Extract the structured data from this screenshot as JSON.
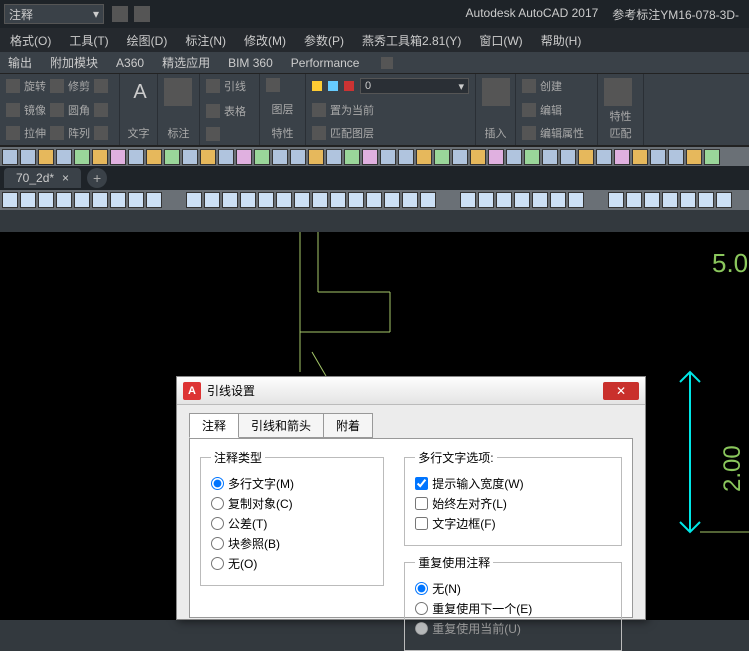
{
  "titlebar": {
    "combo_value": "注释",
    "app": "Autodesk AutoCAD 2017",
    "doc_ref": "参考标注YM16-078-3D-"
  },
  "menubar": [
    "格式(O)",
    "工具(T)",
    "绘图(D)",
    "标注(N)",
    "修改(M)",
    "参数(P)",
    "燕秀工具箱2.81(Y)",
    "窗口(W)",
    "帮助(H)"
  ],
  "ribtabs": [
    "输出",
    "附加模块",
    "A360",
    "精选应用",
    "BIM 360",
    "Performance"
  ],
  "ribbon_labels": {
    "p1a": "旋转",
    "p1b": "修剪",
    "p1c": "镜像",
    "p1d": "圆角",
    "p1e": "拉伸",
    "p1f": "阵列",
    "p2": "文字",
    "p3": "标注",
    "p4a": "引线",
    "p4b": "表格",
    "p5a": "图层",
    "p5b": "特性",
    "p5c": "图层",
    "p6a": "置为当前",
    "p6b": "匹配图层",
    "p7": "插入",
    "p8a": "创建",
    "p8b": "编辑",
    "p8c": "编辑属性",
    "p9a": "特性",
    "p9b": "匹配"
  },
  "byLayerValue": "0",
  "doctab": {
    "name": "70_2d*",
    "close": "×",
    "plus": "+"
  },
  "canvas_text": "5.0",
  "dialog": {
    "title": "引线设置",
    "close": "✕",
    "tabs": [
      "注释",
      "引线和箭头",
      "附着"
    ],
    "group1_title": "注释类型",
    "group1_options": [
      "多行文字(M)",
      "复制对象(C)",
      "公差(T)",
      "块参照(B)",
      "无(O)"
    ],
    "group2_title": "多行文字选项:",
    "group2_options": [
      "提示输入宽度(W)",
      "始终左对齐(L)",
      "文字边框(F)"
    ],
    "group3_title": "重复使用注释",
    "group3_options": [
      "无(N)",
      "重复使用下一个(E)",
      "重复使用当前(U)"
    ]
  }
}
